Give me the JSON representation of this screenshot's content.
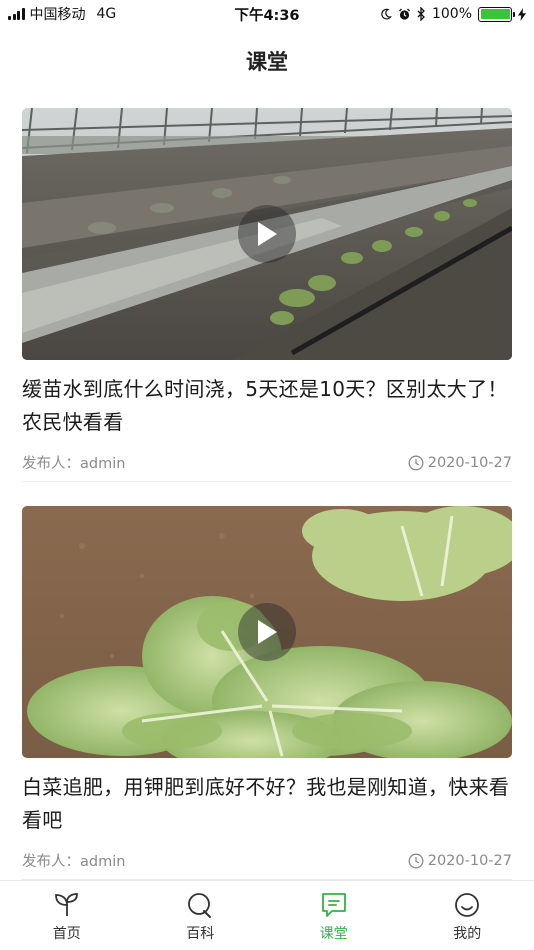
{
  "status_bar": {
    "carrier": "中国移动",
    "network": "4G",
    "time": "下午4:36",
    "battery": "100%",
    "battery_level": 1.0
  },
  "page": {
    "title": "课堂"
  },
  "articles": [
    {
      "title": "缓苗水到底什么时间浇，5天还是10天？区别太大了！农民快看看",
      "publisher_label": "发布人：",
      "publisher": "admin",
      "date": "2020-10-27",
      "thumbnail": "greenhouse-seedling-rows",
      "has_video": true
    },
    {
      "title": "白菜追肥，用钾肥到底好不好？我也是刚知道，快来看看吧",
      "publisher_label": "发布人：",
      "publisher": "admin",
      "date": "2020-10-27",
      "thumbnail": "cabbage-plant",
      "has_video": true
    }
  ],
  "tab_bar": {
    "active": "课堂",
    "accent_color": "#35b04a",
    "tabs": [
      {
        "label": "首页",
        "icon": "sprout-icon"
      },
      {
        "label": "百科",
        "icon": "search-magnifier-icon"
      },
      {
        "label": "课堂",
        "icon": "chat-lesson-icon"
      },
      {
        "label": "我的",
        "icon": "smiley-profile-icon"
      }
    ]
  }
}
